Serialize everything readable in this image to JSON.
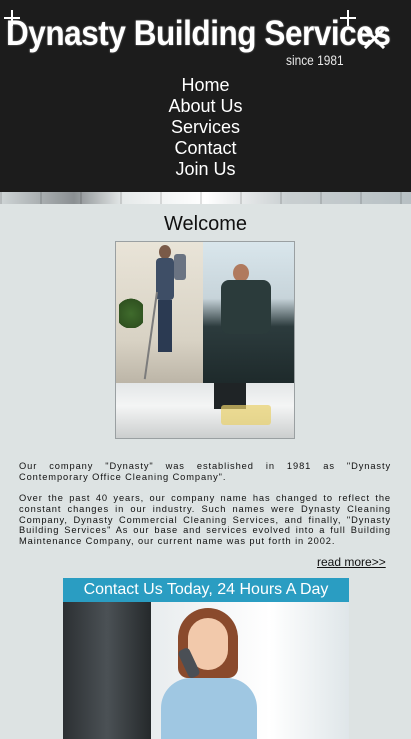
{
  "header": {
    "logo": {
      "title": "Dynasty Building Services",
      "since": "since 1981"
    },
    "close_icon": "close-icon"
  },
  "nav": {
    "items": [
      {
        "label": "Home"
      },
      {
        "label": "About Us"
      },
      {
        "label": "Services"
      },
      {
        "label": "Contact"
      },
      {
        "label": "Join Us"
      }
    ]
  },
  "main": {
    "title": "Welcome",
    "paragraphs": [
      "Our company \"Dynasty\" was established in 1981 as \"Dynasty Contemporary Office Cleaning Company\".",
      "Over the past 40 years, our company name has changed to reflect the constant changes in our industry. Such names were Dynasty Cleaning Company, Dynasty Commercial Cleaning Services, and finally, \"Dynasty Building Services\" As our base and services evolved into a full Building Maintenance Company, our current name was put forth in 2002."
    ],
    "read_more": "read more>>"
  },
  "contact_ad": {
    "headline": "Contact Us Today, 24 Hours A Day"
  },
  "colors": {
    "header_bg": "#1c1c1c",
    "page_bg": "#dde3e3",
    "contact_bar": "#2a9dc2",
    "nav_text": "#ffffff"
  }
}
